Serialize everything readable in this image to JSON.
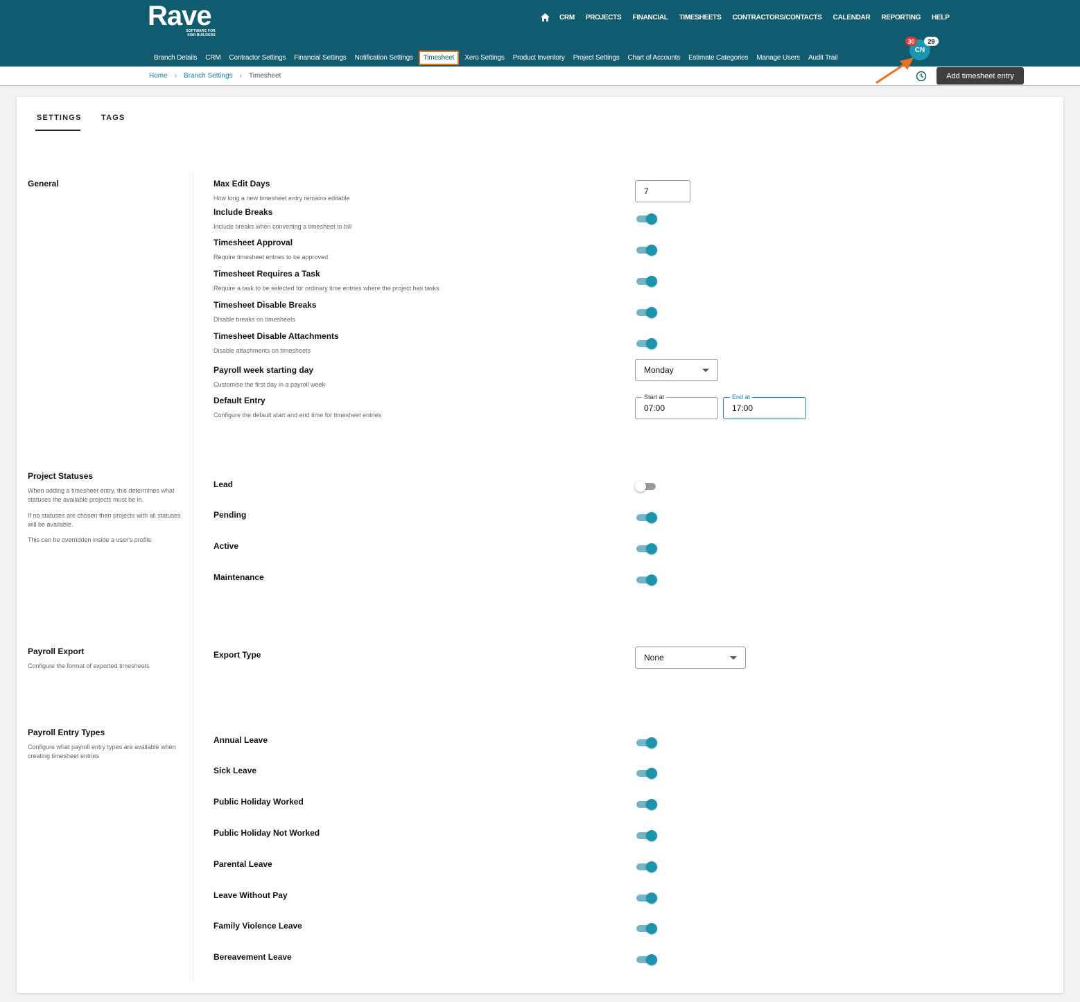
{
  "header": {
    "logo": "Rave",
    "logo_sub_1": "SOFTWARE FOR",
    "logo_sub_2": "KIWI BUILDERS",
    "main_nav": [
      "CRM",
      "PROJECTS",
      "FINANCIAL",
      "TIMESHEETS",
      "CONTRACTORS/CONTACTS",
      "CALENDAR",
      "REPORTING",
      "HELP"
    ],
    "sub_nav": [
      "Branch Details",
      "CRM",
      "Contractor Settings",
      "Financial Settings",
      "Notification Settings",
      "Timesheet",
      "Xero Settings",
      "Product Inventory",
      "Project Settings",
      "Chart of Accounts",
      "Estimate Categories",
      "Manage Users",
      "Audit Trail"
    ],
    "active_sub": "Timesheet",
    "avatar_initials": "CN",
    "badge_red": "30",
    "badge_white": "29"
  },
  "breadcrumb": {
    "home": "Home",
    "branch": "Branch Settings",
    "current": "Timesheet",
    "sep": "›"
  },
  "actions": {
    "add_entry": "Add timesheet entry"
  },
  "tabs": {
    "settings": "SETTINGS",
    "tags": "TAGS"
  },
  "general": {
    "title": "General",
    "max_edit": {
      "label": "Max Edit Days",
      "desc": "How long a new timesheet entry remains editable",
      "value": "7"
    },
    "include_breaks": {
      "label": "Include Breaks",
      "desc": "Include breaks when converting a timesheet to bill",
      "on": true
    },
    "approval": {
      "label": "Timesheet Approval",
      "desc": "Require timesheet entries to be approved",
      "on": true
    },
    "requires_task": {
      "label": "Timesheet Requires a Task",
      "desc": "Require a task to be selected for ordinary time entries where the project has tasks",
      "on": true
    },
    "disable_breaks": {
      "label": "Timesheet Disable Breaks",
      "desc": "Disable breaks on timesheets",
      "on": true
    },
    "disable_attachments": {
      "label": "Timesheet Disable Attachments",
      "desc": "Disable attachments on timesheets",
      "on": true
    },
    "payroll_week": {
      "label": "Payroll week starting day",
      "desc": "Customise the first day in a payroll week",
      "value": "Monday"
    },
    "default_entry": {
      "label": "Default Entry",
      "desc": "Configure the default start and end time for timesheet entries",
      "start_label": "Start at",
      "start_value": "07:00",
      "end_label": "End at",
      "end_value": "17:00"
    }
  },
  "project_statuses": {
    "title": "Project Statuses",
    "desc_1": "When adding a timesheet entry, this determines what statuses the available projects must be in.",
    "desc_2": "If no statuses are chosen then projects with all statuses will be available.",
    "desc_3": "This can be overridden inside a user's profile",
    "items": [
      {
        "label": "Lead",
        "on": false
      },
      {
        "label": "Pending",
        "on": true
      },
      {
        "label": "Active",
        "on": true
      },
      {
        "label": "Maintenance",
        "on": true
      }
    ]
  },
  "payroll_export": {
    "title": "Payroll Export",
    "desc": "Configure the format of exported timesheets",
    "export_label": "Export Type",
    "export_value": "None"
  },
  "payroll_entry_types": {
    "title": "Payroll Entry Types",
    "desc": "Configure what payroll entry types are available when creating timesheet entries",
    "items": [
      {
        "label": "Annual Leave",
        "on": true
      },
      {
        "label": "Sick Leave",
        "on": true
      },
      {
        "label": "Public Holiday Worked",
        "on": true
      },
      {
        "label": "Public Holiday Not Worked",
        "on": true
      },
      {
        "label": "Parental Leave",
        "on": true
      },
      {
        "label": "Leave Without Pay",
        "on": true
      },
      {
        "label": "Family Violence Leave",
        "on": true
      },
      {
        "label": "Bereavement Leave",
        "on": true
      }
    ]
  },
  "colors": {
    "header": "#115b6e",
    "accent": "#1a93ad",
    "highlight": "#e8701f"
  }
}
